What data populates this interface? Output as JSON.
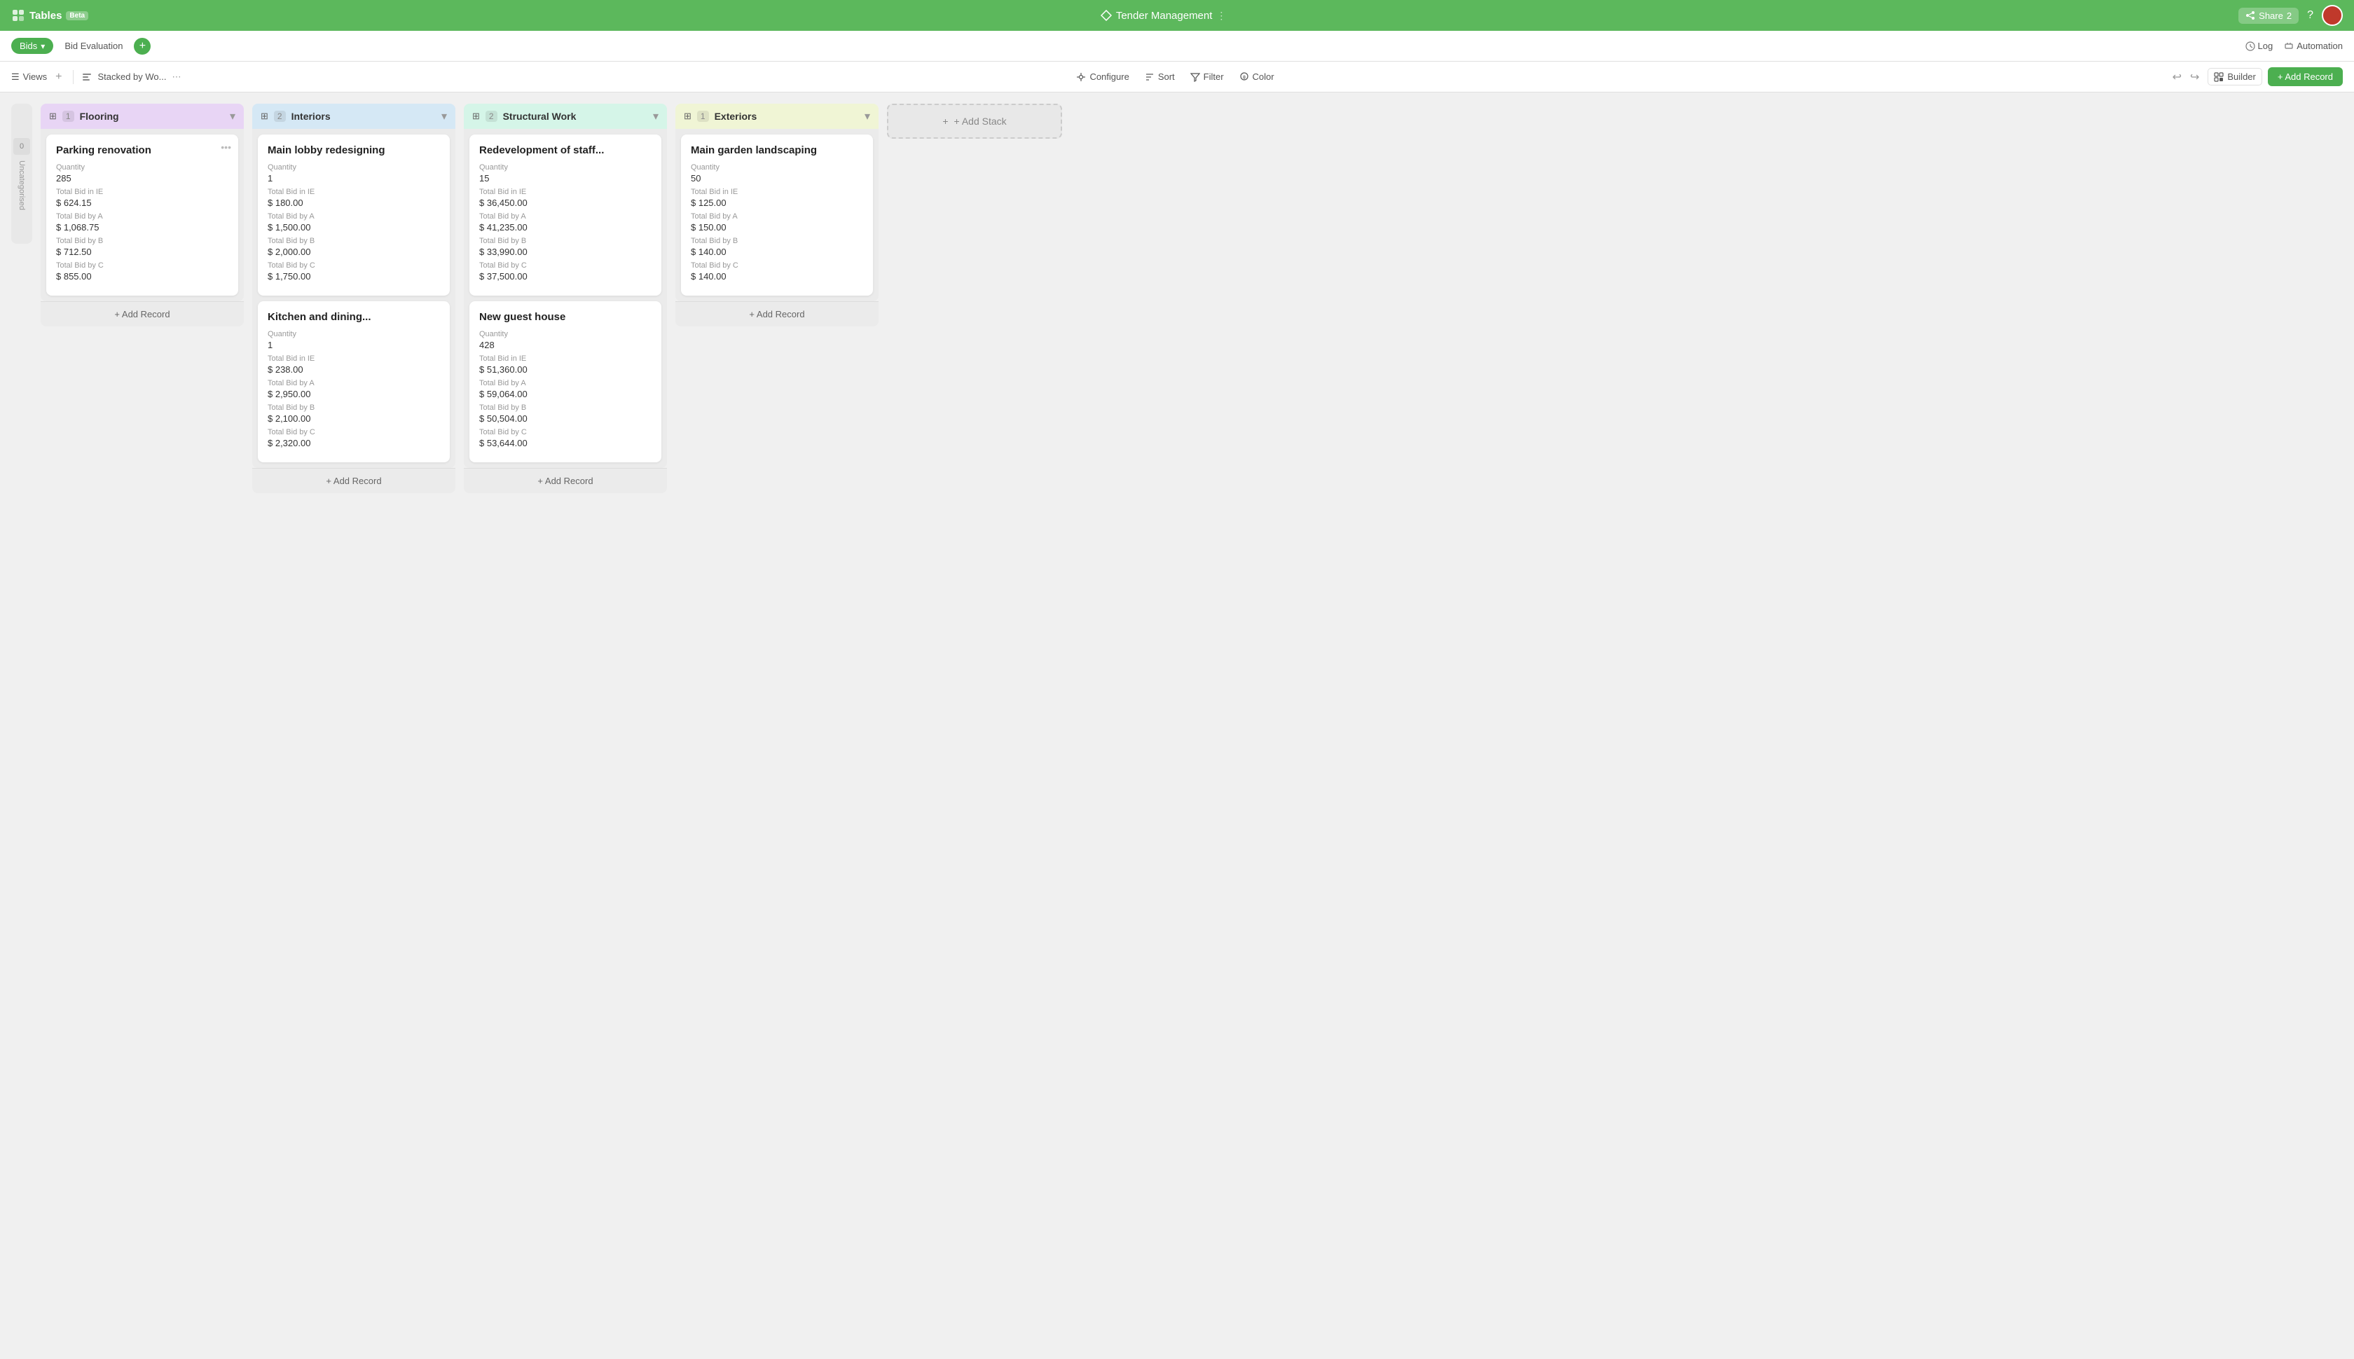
{
  "app": {
    "name": "Tables",
    "beta": "Beta",
    "title": "Tender Management",
    "share_label": "Share",
    "share_count": "2",
    "log_label": "Log",
    "automation_label": "Automation"
  },
  "tabs": {
    "bids_label": "Bids",
    "bid_evaluation_label": "Bid Evaluation"
  },
  "toolbar": {
    "views_label": "Views",
    "stack_label": "Stacked by Wo...",
    "configure_label": "Configure",
    "sort_label": "Sort",
    "filter_label": "Filter",
    "color_label": "Color",
    "builder_label": "Builder",
    "add_record_label": "+ Add Record"
  },
  "side_panel": {
    "label": "Uncategorised",
    "count": "0"
  },
  "stacks": [
    {
      "id": "flooring",
      "name": "Flooring",
      "count": "1",
      "header_class": "stack-header-flooring",
      "cards": [
        {
          "title": "Parking renovation",
          "quantity_label": "Quantity",
          "quantity": "285",
          "bid_ie_label": "Total Bid in IE",
          "bid_ie": "$ 624.15",
          "bid_a_label": "Total Bid by A",
          "bid_a": "$ 1,068.75",
          "bid_b_label": "Total Bid by B",
          "bid_b": "$ 712.50",
          "bid_c_label": "Total Bid by C",
          "bid_c": "$ 855.00"
        }
      ],
      "add_record_label": "+ Add Record"
    },
    {
      "id": "interiors",
      "name": "Interiors",
      "count": "2",
      "header_class": "stack-header-interiors",
      "cards": [
        {
          "title": "Main lobby redesigning",
          "quantity_label": "Quantity",
          "quantity": "1",
          "bid_ie_label": "Total Bid in IE",
          "bid_ie": "$ 180.00",
          "bid_a_label": "Total Bid by A",
          "bid_a": "$ 1,500.00",
          "bid_b_label": "Total Bid by B",
          "bid_b": "$ 2,000.00",
          "bid_c_label": "Total Bid by C",
          "bid_c": "$ 1,750.00"
        },
        {
          "title": "Kitchen and dining...",
          "quantity_label": "Quantity",
          "quantity": "1",
          "bid_ie_label": "Total Bid in IE",
          "bid_ie": "$ 238.00",
          "bid_a_label": "Total Bid by A",
          "bid_a": "$ 2,950.00",
          "bid_b_label": "Total Bid by B",
          "bid_b": "$ 2,100.00",
          "bid_c_label": "Total Bid by C",
          "bid_c": "$ 2,320.00"
        }
      ],
      "add_record_label": "+ Add Record"
    },
    {
      "id": "structural",
      "name": "Structural Work",
      "count": "2",
      "header_class": "stack-header-structural",
      "cards": [
        {
          "title": "Redevelopment of staff...",
          "quantity_label": "Quantity",
          "quantity": "15",
          "bid_ie_label": "Total Bid in IE",
          "bid_ie": "$ 36,450.00",
          "bid_a_label": "Total Bid by A",
          "bid_a": "$ 41,235.00",
          "bid_b_label": "Total Bid by B",
          "bid_b": "$ 33,990.00",
          "bid_c_label": "Total Bid by C",
          "bid_c": "$ 37,500.00"
        },
        {
          "title": "New guest house",
          "quantity_label": "Quantity",
          "quantity": "428",
          "bid_ie_label": "Total Bid in IE",
          "bid_ie": "$ 51,360.00",
          "bid_a_label": "Total Bid by A",
          "bid_a": "$ 59,064.00",
          "bid_b_label": "Total Bid by B",
          "bid_b": "$ 50,504.00",
          "bid_c_label": "Total Bid by C",
          "bid_c": "$ 53,644.00"
        }
      ],
      "add_record_label": "+ Add Record"
    },
    {
      "id": "exteriors",
      "name": "Exteriors",
      "count": "1",
      "header_class": "stack-header-exteriors",
      "cards": [
        {
          "title": "Main garden landscaping",
          "quantity_label": "Quantity",
          "quantity": "50",
          "bid_ie_label": "Total Bid in IE",
          "bid_ie": "$ 125.00",
          "bid_a_label": "Total Bid by A",
          "bid_a": "$ 150.00",
          "bid_b_label": "Total Bid by B",
          "bid_b": "$ 140.00",
          "bid_c_label": "Total Bid by C",
          "bid_c": "$ 140.00"
        }
      ],
      "add_record_label": "+ Add Record"
    }
  ],
  "add_stack_label": "+ Add Stack"
}
